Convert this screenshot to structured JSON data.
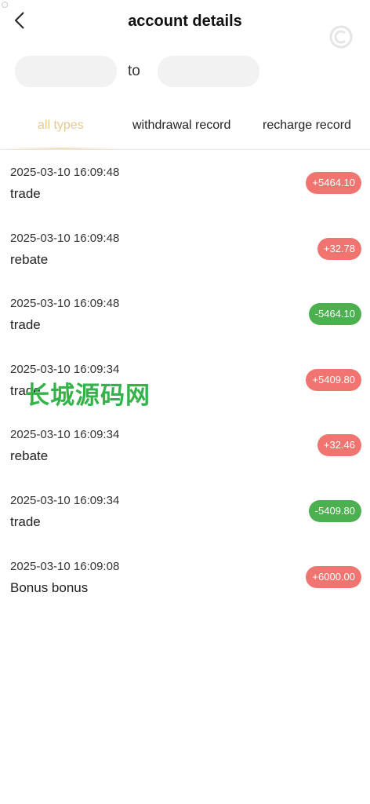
{
  "header": {
    "title": "account details"
  },
  "date_range": {
    "start": "",
    "end": "",
    "separator": "to"
  },
  "tabs": [
    {
      "label": "all types",
      "active": true
    },
    {
      "label": "withdrawal record",
      "active": false
    },
    {
      "label": "recharge record",
      "active": false
    }
  ],
  "records": [
    {
      "time": "2025-03-10 16:09:48",
      "type": "trade",
      "amount": "+5464.10",
      "direction": "pos"
    },
    {
      "time": "2025-03-10 16:09:48",
      "type": "rebate",
      "amount": "+32.78",
      "direction": "pos"
    },
    {
      "time": "2025-03-10 16:09:48",
      "type": "trade",
      "amount": "-5464.10",
      "direction": "neg"
    },
    {
      "time": "2025-03-10 16:09:34",
      "type": "trade",
      "amount": "+5409.80",
      "direction": "pos"
    },
    {
      "time": "2025-03-10 16:09:34",
      "type": "rebate",
      "amount": "+32.46",
      "direction": "pos"
    },
    {
      "time": "2025-03-10 16:09:34",
      "type": "trade",
      "amount": "-5409.80",
      "direction": "neg"
    },
    {
      "time": "2025-03-10 16:09:08",
      "type": "Bonus bonus",
      "amount": "+6000.00",
      "direction": "pos"
    }
  ],
  "watermark": {
    "text": "长城源码网"
  },
  "colors": {
    "positive": "#f07570",
    "negative": "#4caf50",
    "active_tab": "#e8c98e",
    "watermark": "#35b34a"
  }
}
